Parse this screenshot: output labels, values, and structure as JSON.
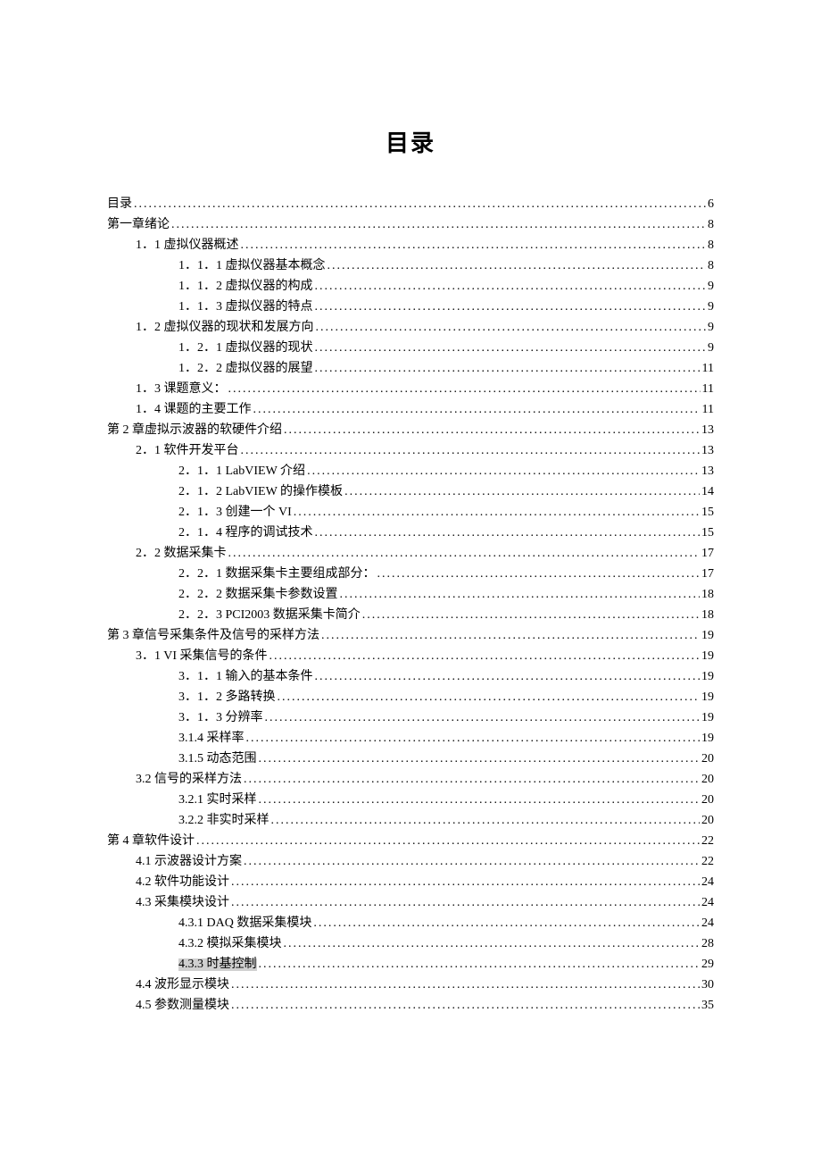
{
  "title": "目录",
  "toc": [
    {
      "level": 0,
      "label": "目录",
      "page": "6"
    },
    {
      "level": 0,
      "label": "第一章绪论",
      "page": "8"
    },
    {
      "level": 1,
      "label": "1．1 虚拟仪器概述",
      "page": "8"
    },
    {
      "level": 2,
      "label": "1．1．1 虚拟仪器基本概念",
      "page": "8"
    },
    {
      "level": 2,
      "label": "1．1．2 虚拟仪器的构成",
      "page": "9"
    },
    {
      "level": 2,
      "label": "1．1．3 虚拟仪器的特点",
      "page": "9"
    },
    {
      "level": 1,
      "label": "1．2 虚拟仪器的现状和发展方向",
      "page": "9"
    },
    {
      "level": 2,
      "label": "1．2．1 虚拟仪器的现状",
      "page": "9"
    },
    {
      "level": 2,
      "label": "1．2．2 虚拟仪器的展望",
      "page": "11"
    },
    {
      "level": 1,
      "label": "1．3 课题意义：",
      "page": "11"
    },
    {
      "level": 1,
      "label": "1．4 课题的主要工作",
      "page": "11"
    },
    {
      "level": 0,
      "label": "第 2 章虚拟示波器的软硬件介绍",
      "page": "13"
    },
    {
      "level": 1,
      "label": "2．1 软件开发平台",
      "page": "13"
    },
    {
      "level": 2,
      "label": "2．1．1 LabVIEW 介绍",
      "page": "13"
    },
    {
      "level": 2,
      "label": "2．1．2 LabVIEW 的操作模板",
      "page": "14"
    },
    {
      "level": 2,
      "label": "2．1．3 创建一个 VI",
      "page": "15"
    },
    {
      "level": 2,
      "label": "2．1．4 程序的调试技术",
      "page": "15"
    },
    {
      "level": 1,
      "label": "2．2 数据采集卡",
      "page": "17"
    },
    {
      "level": 2,
      "label": "2．2．1 数据采集卡主要组成部分：",
      "page": "17"
    },
    {
      "level": 2,
      "label": "2．2．2 数据采集卡参数设置",
      "page": "18"
    },
    {
      "level": 2,
      "label": "2．2．3 PCI2003 数据采集卡简介",
      "page": "18"
    },
    {
      "level": 0,
      "label": "第 3 章信号采集条件及信号的采样方法",
      "page": "19"
    },
    {
      "level": 1,
      "label": "3．1 VI 采集信号的条件",
      "page": "19"
    },
    {
      "level": 2,
      "label": "3．1．1 输入的基本条件",
      "page": "19"
    },
    {
      "level": 2,
      "label": "3．1．2  多路转换",
      "page": "19"
    },
    {
      "level": 2,
      "label": "3．1．3  分辨率",
      "page": "19"
    },
    {
      "level": 2,
      "label": "3.1.4 采样率",
      "page": "19"
    },
    {
      "level": 2,
      "label": "3.1.5 动态范围",
      "page": "20"
    },
    {
      "level": 1,
      "label": "3.2 信号的采样方法",
      "page": "20"
    },
    {
      "level": 2,
      "label": "3.2.1 实时采样",
      "page": "20"
    },
    {
      "level": 2,
      "label": "3.2.2 非实时采样",
      "page": "20"
    },
    {
      "level": 0,
      "label": "第 4 章软件设计",
      "page": "22"
    },
    {
      "level": 1,
      "label": "4.1  示波器设计方案",
      "page": "22"
    },
    {
      "level": 1,
      "label": "4.2  软件功能设计",
      "page": "24"
    },
    {
      "level": 1,
      "label": "4.3  采集模块设计",
      "page": "24"
    },
    {
      "level": 2,
      "label": "4.3.1 DAQ 数据采集模块",
      "page": "24"
    },
    {
      "level": 2,
      "label": "4.3.2 模拟采集模块",
      "page": "28"
    },
    {
      "level": 2,
      "label": "4.3.3 时基控制",
      "page": "29",
      "highlight": true
    },
    {
      "level": 1,
      "label": "4.4 波形显示模块",
      "page": "30"
    },
    {
      "level": 1,
      "label": "4.5 参数测量模块",
      "page": "35"
    }
  ]
}
